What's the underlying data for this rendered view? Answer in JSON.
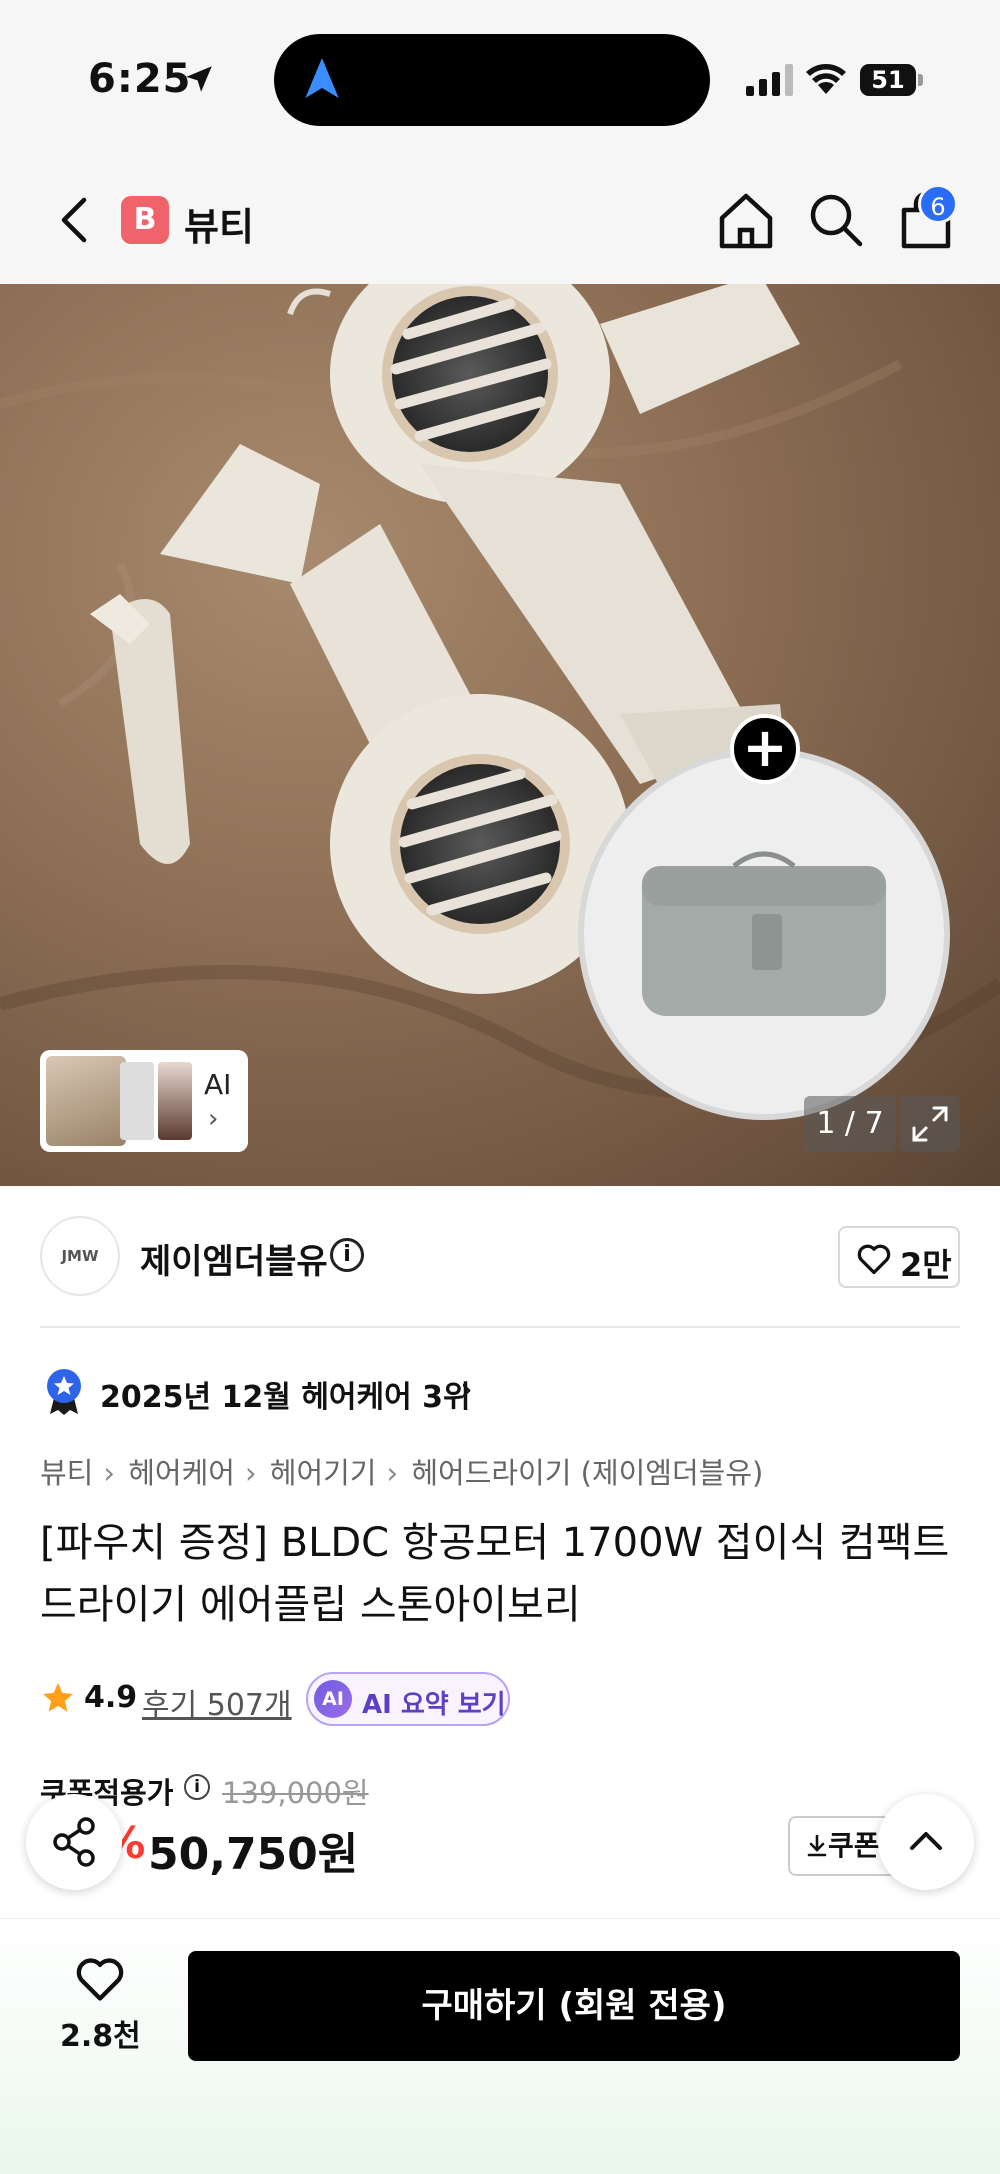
{
  "status_bar": {
    "time": "6:25",
    "battery": "51"
  },
  "header": {
    "brand_initial": "B",
    "title": "뷰티",
    "cart_count": "6"
  },
  "gallery": {
    "ai_label": "AI",
    "ai_chevron": "›",
    "page_indicator": "1 / 7"
  },
  "seller": {
    "logo_text": "JMW",
    "name": "제이엠더블유",
    "info_icon": "i",
    "like_count": "2만"
  },
  "ranking": {
    "text": "2025년 12월 헤어케어 3위",
    "chevron": "›"
  },
  "breadcrumb": [
    "뷰티",
    "헤어케어",
    "헤어기기",
    "헤어드라이기 (제이엠더블유)"
  ],
  "breadcrumb_sep": "›",
  "product": {
    "title": "[파우치 증정] BLDC 항공모터 1700W 접이식 컴팩트 드라이기 에어플립 스톤아이보리",
    "rating": "4.9",
    "review_link": "후기 507개",
    "ai_badge": "AI",
    "ai_summary": "AI 요약 보기"
  },
  "price": {
    "coupon_label": "쿠폰적용가",
    "info_icon": "i",
    "original": "139,000원",
    "discount": "63%",
    "sale": "50,750원",
    "coupon_button": "쿠폰 받기"
  },
  "bottom_bar": {
    "wishlist_count": "2.8천",
    "buy_button": "구매하기 (회원 전용)"
  },
  "colors": {
    "accent_red": "#ff3b30",
    "brand_pink": "#f0636b",
    "badge_blue": "#2b6cf6",
    "ai_purple": "#5b3fc4"
  },
  "icons": [
    "location-arrow-icon",
    "signal-icon",
    "wifi-icon",
    "back-icon",
    "home-icon",
    "search-icon",
    "cart-icon",
    "expand-icon",
    "plus-icon",
    "heart-icon",
    "medal-icon",
    "star-icon",
    "share-icon",
    "chevron-up-icon",
    "download-icon"
  ]
}
